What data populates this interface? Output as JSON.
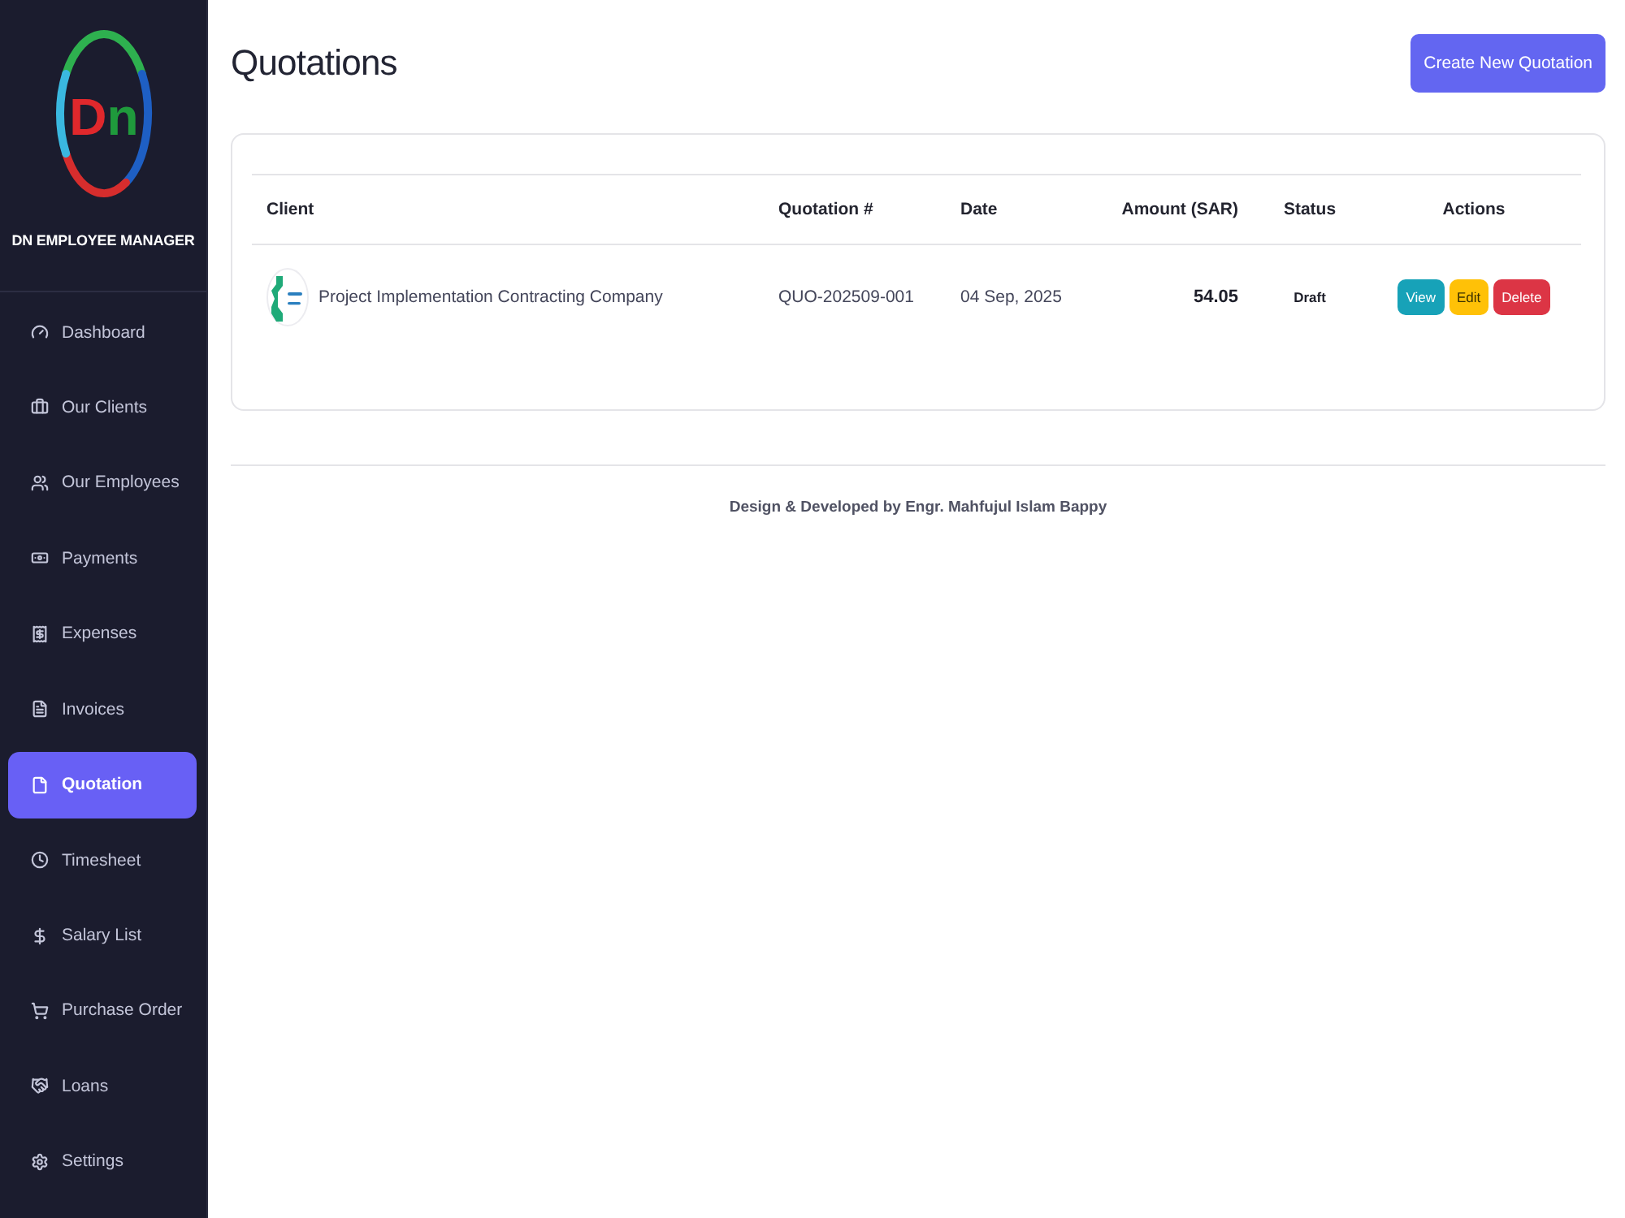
{
  "sidebar": {
    "logo_mark": "Dn",
    "brand": "DN EMPLOYEE MANAGER",
    "items": [
      {
        "label": "Dashboard",
        "selected": false
      },
      {
        "label": "Our Clients",
        "selected": false
      },
      {
        "label": "Our Employees",
        "selected": false
      },
      {
        "label": "Payments",
        "selected": false
      },
      {
        "label": "Expenses",
        "selected": false
      },
      {
        "label": "Invoices",
        "selected": false
      },
      {
        "label": "Quotation",
        "selected": true
      },
      {
        "label": "Timesheet",
        "selected": false
      },
      {
        "label": "Salary List",
        "selected": false
      },
      {
        "label": "Purchase Order",
        "selected": false
      },
      {
        "label": "Loans",
        "selected": false
      },
      {
        "label": "Settings",
        "selected": false
      }
    ]
  },
  "header": {
    "title": "Quotations",
    "action": "Create New Quotation"
  },
  "table": {
    "columns": [
      "Client",
      "Quotation #",
      "Date",
      "Amount (SAR)",
      "Status",
      "Actions"
    ],
    "rows": [
      {
        "client": "Project Implementation Contracting Company",
        "number": "QUO-202509-001",
        "date": "04 Sep, 2025",
        "amount": "54.05",
        "status": "Draft",
        "actions": [
          {
            "kind": "view",
            "label": "View"
          },
          {
            "kind": "edit",
            "label": "Edit"
          },
          {
            "kind": "delete",
            "label": "Delete"
          }
        ]
      }
    ]
  },
  "footer": "Design & Developed by Engr. Mahfujul Islam Bappy"
}
